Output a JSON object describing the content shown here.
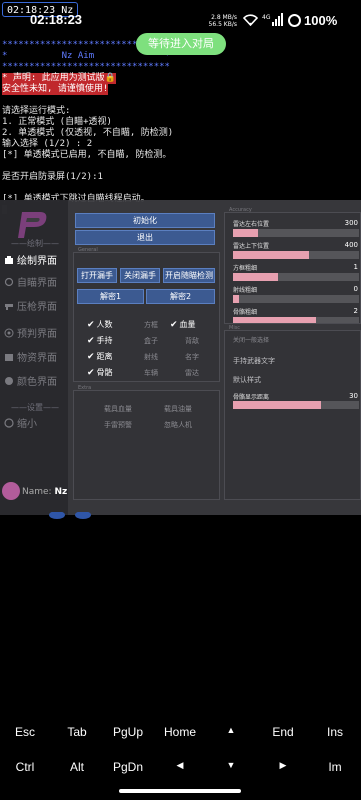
{
  "status": {
    "rec_time": "02:18:23",
    "rec_tag": "Nz",
    "clock": "02:18:23",
    "speed_top": "2.8 MB/s",
    "speed_bottom": "56.5 KB/s",
    "network": "4G",
    "battery": "100%",
    "icons": [
      "wifi-icon",
      "signal-icon",
      "battery-icon"
    ]
  },
  "toast": "等待进入对局",
  "terminal": {
    "lines": [
      "*******************************",
      "*          Nz Aim             *",
      "*******************************",
      "* 声明: 此应用为测试版🔒",
      "安全性未知, 请谨慎使用!",
      "",
      "请选择运行模式:",
      "1. 正常模式 (自瞄+透视)",
      "2. 单透模式 (仅透视, 不自瞄, 防检测)",
      "输入选择 (1/2) : 2",
      "[*] 单透模式已启用, 不自瞄, 防检测。",
      "",
      "是否开启防录屏(1/2):1",
      "",
      "[*] 单透模式下跳过自瞄线程启动。"
    ]
  },
  "menu": {
    "sidebar": {
      "sep_draw": "——绘制——",
      "items": [
        "绘制界面",
        "自瞄界面",
        "压枪界面",
        "预判界面",
        "物资界面",
        "颜色界面"
      ],
      "sep_settings": "——设置——",
      "minimize": "缩小",
      "name_label": "Name:",
      "name_value": "Nz"
    },
    "top_buttons": [
      "初始化",
      "退出"
    ],
    "general_title": "General",
    "general_buttons": [
      "打开漏手",
      "关闭漏手",
      "开启随瞄检测",
      "解密1",
      "解密2"
    ],
    "checks": [
      {
        "label": "人数",
        "checked": true
      },
      {
        "label": "方框",
        "checked": false
      },
      {
        "label": "血量",
        "checked": true
      },
      {
        "label": "手持",
        "checked": true
      },
      {
        "label": "盒子",
        "checked": false
      },
      {
        "label": "背敌",
        "checked": false
      },
      {
        "label": "距离",
        "checked": true
      },
      {
        "label": "射线",
        "checked": false
      },
      {
        "label": "名字",
        "checked": false
      },
      {
        "label": "骨骼",
        "checked": true
      },
      {
        "label": "车辆",
        "checked": false
      },
      {
        "label": "雷达",
        "checked": false
      }
    ],
    "extra_title": "Extra",
    "extra_items": [
      "载具血量",
      "载具油量",
      "手雷预警",
      "忽略人机"
    ],
    "accuracy_title": "Accuracy",
    "sliders": [
      {
        "label": "雷达左右位置",
        "value": "300",
        "fill": 0.2
      },
      {
        "label": "雷达上下位置",
        "value": "400",
        "fill": 0.6
      },
      {
        "label": "方框粗细",
        "value": "1",
        "fill": 0.36
      },
      {
        "label": "射线粗细",
        "value": "0",
        "fill": 0.05
      },
      {
        "label": "骨骼粗细",
        "value": "2",
        "fill": 0.66
      }
    ],
    "misc_title": "Misc",
    "misc_items": [
      "关闭一般选择",
      "手持武器文字",
      "默认样式"
    ],
    "bone_slider": {
      "label": "骨骼显示距离",
      "value": "30",
      "fill": 0.7
    }
  },
  "keys": {
    "row1": [
      "Esc",
      "Tab",
      "PgUp",
      "Home",
      "▲",
      "End",
      "Ins"
    ],
    "row2": [
      "Ctrl",
      "Alt",
      "PgDn",
      "◀",
      "▼",
      "▶",
      "Im"
    ]
  }
}
